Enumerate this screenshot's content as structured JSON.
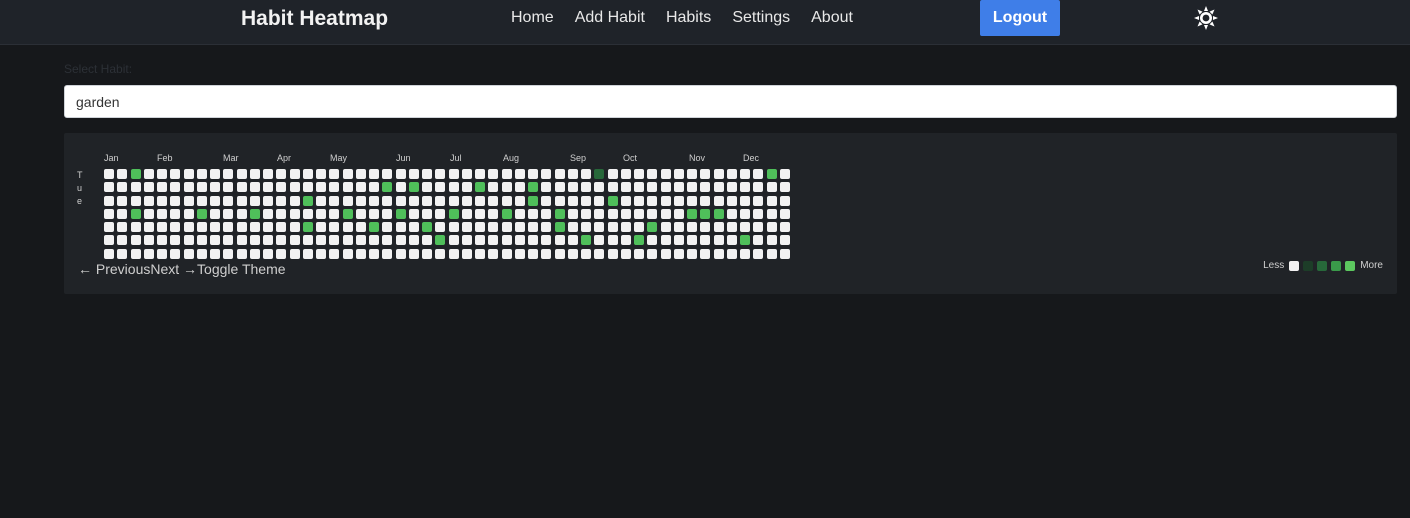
{
  "navbar": {
    "brand": "Habit Heatmap",
    "links": [
      "Home",
      "Add Habit",
      "Habits",
      "Settings",
      "About"
    ],
    "logout_label": "Logout",
    "theme_icon": "sun-icon"
  },
  "habit_select": {
    "label": "Select Habit:",
    "value": "garden"
  },
  "heatmap": {
    "months": [
      "Jan",
      "Feb",
      "Mar",
      "Apr",
      "May",
      "Jun",
      "Jul",
      "Aug",
      "Sep",
      "Oct",
      "Nov",
      "Dec"
    ],
    "day_letters": [
      "T",
      "u",
      "e"
    ],
    "weeks": 52,
    "days_per_week": 7,
    "colors": {
      "empty": "#f2f2f2",
      "level1": "#27683a",
      "level2": "#3a9a4a",
      "level3": "#4fbf5a",
      "level4": "#6ad26b"
    },
    "active_cells": [
      {
        "week": 2,
        "day": 0,
        "level": 3
      },
      {
        "week": 21,
        "day": 1,
        "level": 3
      },
      {
        "week": 23,
        "day": 1,
        "level": 3
      },
      {
        "week": 28,
        "day": 1,
        "level": 3
      },
      {
        "week": 32,
        "day": 1,
        "level": 3
      },
      {
        "week": 15,
        "day": 2,
        "level": 3
      },
      {
        "week": 32,
        "day": 2,
        "level": 3
      },
      {
        "week": 38,
        "day": 2,
        "level": 3
      },
      {
        "week": 37,
        "day": 0,
        "level": 1
      },
      {
        "week": 50,
        "day": 0,
        "level": 3
      },
      {
        "week": 2,
        "day": 3,
        "level": 3
      },
      {
        "week": 7,
        "day": 3,
        "level": 3
      },
      {
        "week": 11,
        "day": 3,
        "level": 3
      },
      {
        "week": 18,
        "day": 3,
        "level": 3
      },
      {
        "week": 22,
        "day": 3,
        "level": 3
      },
      {
        "week": 26,
        "day": 3,
        "level": 3
      },
      {
        "week": 30,
        "day": 3,
        "level": 3
      },
      {
        "week": 34,
        "day": 3,
        "level": 3
      },
      {
        "week": 44,
        "day": 3,
        "level": 3
      },
      {
        "week": 45,
        "day": 3,
        "level": 3
      },
      {
        "week": 46,
        "day": 3,
        "level": 3
      },
      {
        "week": 15,
        "day": 4,
        "level": 3
      },
      {
        "week": 20,
        "day": 4,
        "level": 3
      },
      {
        "week": 24,
        "day": 4,
        "level": 3
      },
      {
        "week": 34,
        "day": 4,
        "level": 3
      },
      {
        "week": 41,
        "day": 4,
        "level": 3
      },
      {
        "week": 25,
        "day": 5,
        "level": 3
      },
      {
        "week": 36,
        "day": 5,
        "level": 3
      },
      {
        "week": 40,
        "day": 5,
        "level": 3
      },
      {
        "week": 48,
        "day": 5,
        "level": 3
      }
    ],
    "controls": [
      "← Previous",
      "Next →",
      "Toggle Theme"
    ],
    "legend": {
      "less": "Less",
      "more": "More"
    }
  }
}
